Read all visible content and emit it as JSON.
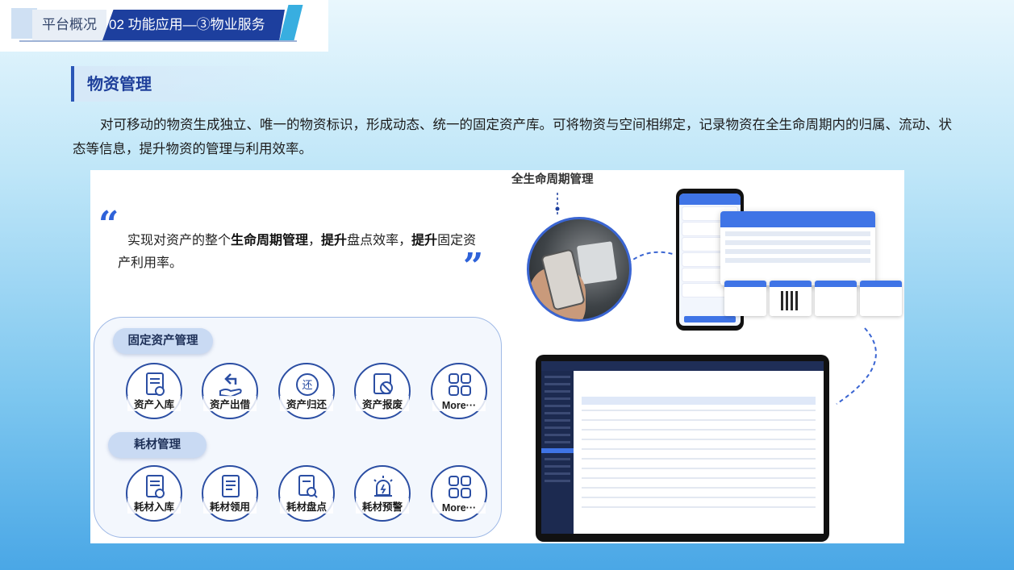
{
  "header": {
    "tab1": "平台概况",
    "tab2": "02 功能应用—③物业服务"
  },
  "section": {
    "title": "物资管理",
    "paragraph": "对可移动的物资生成独立、唯一的物资标识，形成动态、统一的固定资产库。可将物资与空间相绑定，记录物资在全生命周期内的归属、流动、状态等信息，提升物资的管理与利用效率。"
  },
  "figure": {
    "quote_open": "“",
    "quote_close": "”",
    "quote_parts": [
      "实现对资产的整个",
      "生命周期管理",
      "，",
      "提升",
      "盘点效率，",
      "提升",
      "固定资产利用率。"
    ],
    "lifecycle_title": "全生命周期管理",
    "fixed_assets": {
      "label": "固定资产管理",
      "items": [
        "资产入库",
        "资产出借",
        "资产归还",
        "资产报废",
        "More···"
      ]
    },
    "consumables": {
      "label": "耗材管理",
      "items": [
        "耗材入库",
        "耗材领用",
        "耗材盘点",
        "耗材预警",
        "More···"
      ]
    }
  },
  "colors": {
    "brand_blue": "#1d3f9e",
    "accent_blue": "#2e62d9",
    "accent_cyan": "#38aee0"
  }
}
